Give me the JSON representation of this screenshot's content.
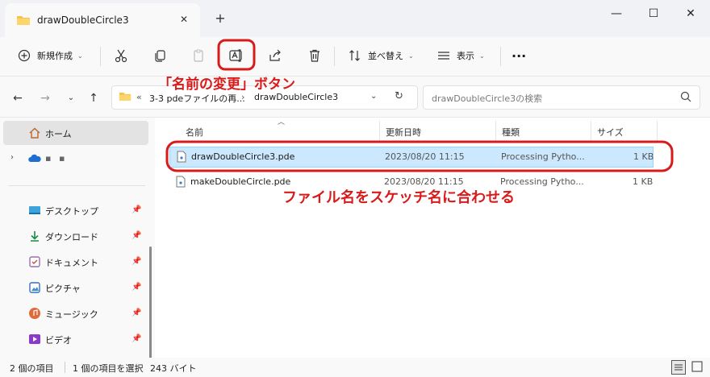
{
  "window": {
    "tab_title": "drawDoubleCircle3",
    "tab_close": "✕",
    "new_tab": "+",
    "minimize": "—",
    "maximize": "☐",
    "close": "✕"
  },
  "toolbar": {
    "new_label": "新規作成",
    "sort_label": "並べ替え",
    "view_label": "表示",
    "more": "···"
  },
  "address": {
    "prefix": "«",
    "crumbs": [
      "3-3 pdeファイルの再...",
      "drawDoubleCircle3"
    ],
    "separator": "›",
    "search_placeholder": "drawDoubleCircle3の検索"
  },
  "nav": {
    "home": "ホーム",
    "cloud_label": "▪ ▪",
    "items": [
      {
        "label": "デスクトップ",
        "icon": "desktop-icon"
      },
      {
        "label": "ダウンロード",
        "icon": "download-icon"
      },
      {
        "label": "ドキュメント",
        "icon": "document-icon"
      },
      {
        "label": "ピクチャ",
        "icon": "picture-icon"
      },
      {
        "label": "ミュージック",
        "icon": "music-icon"
      },
      {
        "label": "ビデオ",
        "icon": "video-icon"
      }
    ]
  },
  "columns": {
    "name": "名前",
    "date": "更新日時",
    "type": "種類",
    "size": "サイズ"
  },
  "files": [
    {
      "name": "drawDoubleCircle3.pde",
      "date": "2023/08/20 11:15",
      "type": "Processing Pytho...",
      "size": "1 KB",
      "selected": true
    },
    {
      "name": "makeDoubleCircle.pde",
      "date": "2023/08/20 11:15",
      "type": "Processing Pytho...",
      "size": "1 KB",
      "selected": false
    }
  ],
  "annotations": {
    "rename_label": "「名前の変更」ボタン",
    "rename_note": "ファイル名をスケッチ名に合わせる",
    "color": "#d91a1a"
  },
  "status": {
    "count": "2 個の項目",
    "selection": "1 個の項目を選択",
    "bytes": "243 バイト"
  }
}
